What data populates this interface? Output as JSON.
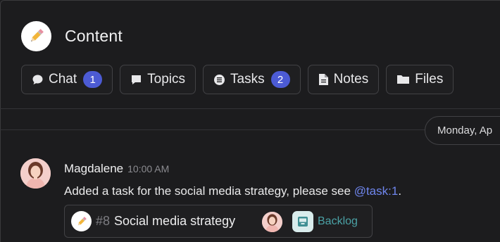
{
  "header": {
    "title": "Content",
    "logo_icon": "pencil-icon"
  },
  "tabs": [
    {
      "label": "Chat",
      "icon": "chat-bubble-icon",
      "badge": "1"
    },
    {
      "label": "Topics",
      "icon": "comment-icon"
    },
    {
      "label": "Tasks",
      "icon": "list-icon",
      "badge": "2"
    },
    {
      "label": "Notes",
      "icon": "document-icon"
    },
    {
      "label": "Files",
      "icon": "folder-icon"
    }
  ],
  "date_separator": "Monday, Ap",
  "message": {
    "author": "Magdalene",
    "time": "10:00 AM",
    "text": "Added a task for the social media strategy, please see ",
    "mention": "@task:1",
    "text_end": "."
  },
  "task_card": {
    "number": "#8",
    "title": "Social media strategy",
    "status": "Backlog",
    "status_color": "#4ba2a6"
  },
  "colors": {
    "accent": "#4c5bd4",
    "mention": "#6f86ee",
    "background": "#1c1c1e"
  }
}
